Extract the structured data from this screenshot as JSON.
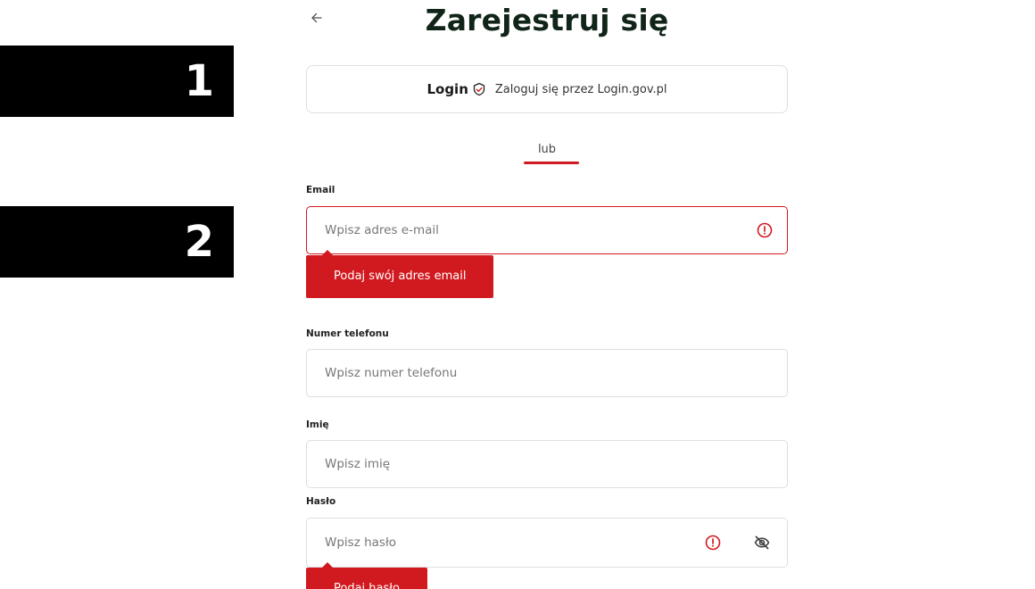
{
  "steps": [
    "1",
    "2"
  ],
  "header": {
    "back_icon": "arrow-left-icon",
    "title": "Zarejestruj się"
  },
  "login_gov": {
    "logo_text": "Login",
    "logo_icon": "login-gov-shield-icon",
    "label": "Zaloguj się przez Login.gov.pl"
  },
  "divider": {
    "text": "lub"
  },
  "form": {
    "email": {
      "label": "Email",
      "placeholder": "Wpisz adres e-mail",
      "value": "",
      "error": "Podaj swój adres email",
      "icon": "alert-circle-icon"
    },
    "phone": {
      "label": "Numer telefonu",
      "placeholder": "Wpisz numer telefonu",
      "value": ""
    },
    "name": {
      "label": "Imię",
      "placeholder": "Wpisz imię",
      "value": ""
    },
    "password": {
      "label": "Hasło",
      "placeholder": "Wpisz hasło",
      "value": "",
      "error": "Podaj hasło",
      "icon": "alert-circle-icon",
      "toggle_icon": "eye-off-icon"
    }
  },
  "colors": {
    "accent": "#d11a1f",
    "title": "#102417",
    "border": "#dcdfe3"
  }
}
